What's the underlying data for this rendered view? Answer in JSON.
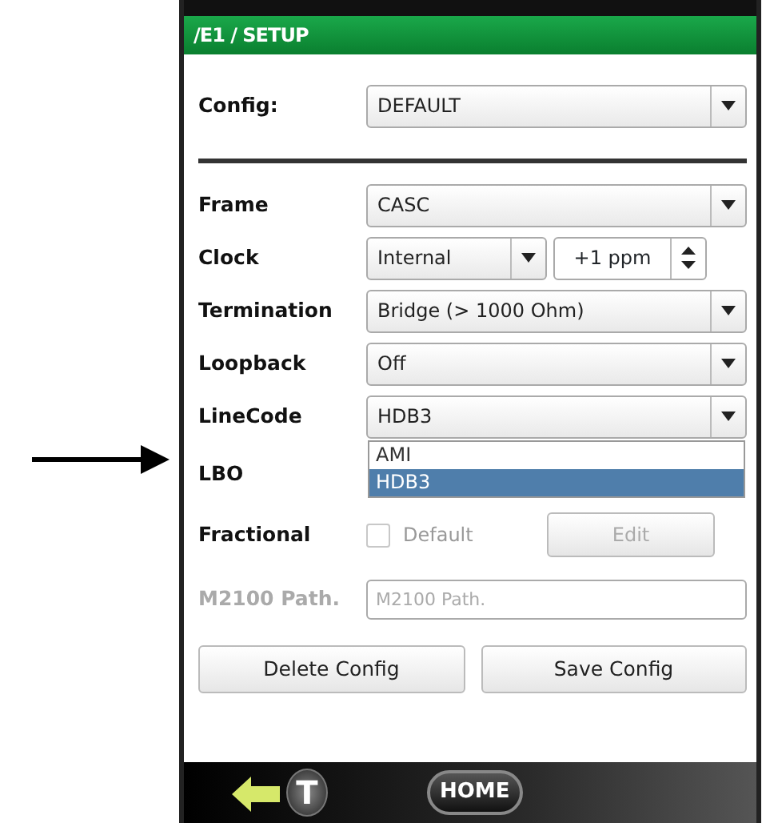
{
  "window": {
    "title": "/E1 / SETUP"
  },
  "config": {
    "label": "Config:",
    "value": "DEFAULT"
  },
  "rows": [
    {
      "kind": "select",
      "label": "Frame",
      "value": "CASC"
    },
    {
      "kind": "select-spin",
      "label": "Clock",
      "value": "Internal",
      "spin_value": "+1 ppm"
    },
    {
      "kind": "select",
      "label": "Termination",
      "value": "Bridge (> 1000 Ohm)"
    },
    {
      "kind": "select",
      "label": "Loopback",
      "value": "Off"
    },
    {
      "kind": "select",
      "label": "LineCode",
      "value": "HDB3",
      "expanded": true,
      "options": [
        {
          "label": "AMI",
          "selected": false
        },
        {
          "label": "HDB3",
          "selected": true
        }
      ]
    },
    {
      "kind": "label",
      "label": "LBO"
    },
    {
      "kind": "checkbox",
      "label": "Fractional",
      "checkbox_label": "Default",
      "checked": false,
      "disabled": true,
      "button": "Edit"
    },
    {
      "kind": "text",
      "label": "M2100 Path.",
      "placeholder": "M2100 Path.",
      "disabled": true
    }
  ],
  "buttons": [
    "Delete Config",
    "Save Config"
  ],
  "bottom_bar": {
    "t_label": "T",
    "home_label": "HOME"
  }
}
